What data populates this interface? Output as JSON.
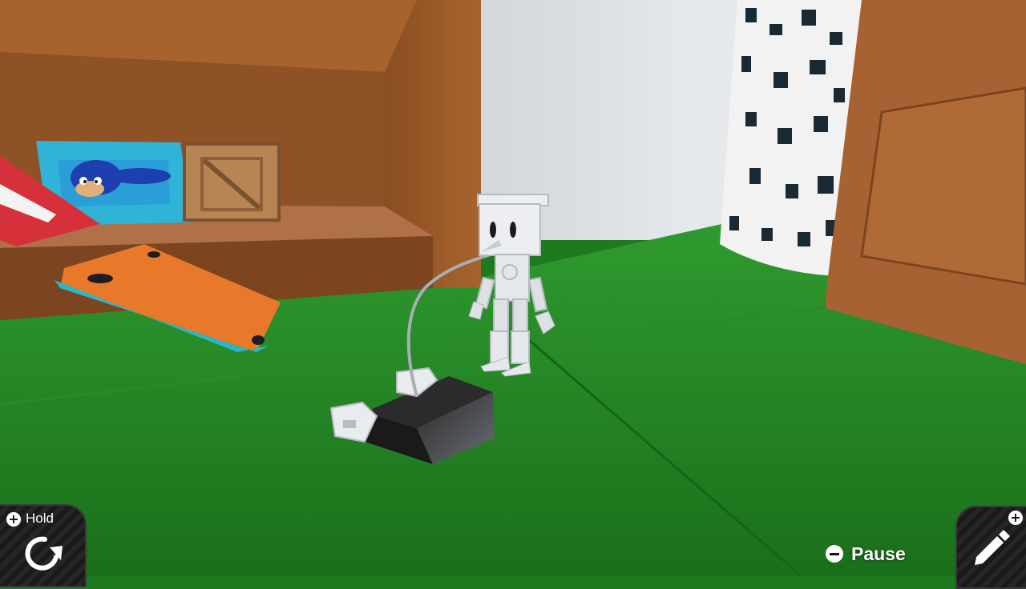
{
  "hud": {
    "hold": {
      "label": "Hold",
      "icon": "rotate-icon",
      "badge_icon": "plus-button-icon"
    },
    "pause": {
      "label": "Pause",
      "icon": "minus-button-icon"
    },
    "edit": {
      "icon": "pencil-icon",
      "badge_icon": "plus-button-icon"
    }
  },
  "colors": {
    "floor": "#1f7a1f",
    "wall": "#dfe3e8",
    "wood": "#9a5a2a",
    "orange_panel": "#e8792a",
    "teal_edge": "#29b6c6"
  }
}
